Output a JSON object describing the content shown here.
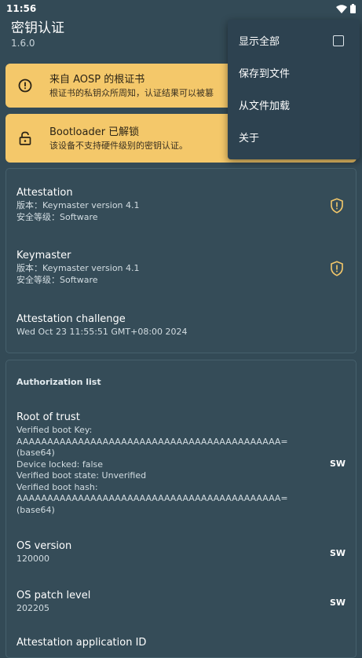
{
  "status_bar": {
    "time": "11:56"
  },
  "app_bar": {
    "title": "密钥认证",
    "version": "1.6.0"
  },
  "warnings": [
    {
      "title": "来自 AOSP 的根证书",
      "desc": "根证书的私钥众所周知，认证结果可以被篡"
    },
    {
      "title": "Bootloader 已解锁",
      "desc": "该设备不支持硬件级别的密钥认证。"
    }
  ],
  "menu": {
    "show_all": "显示全部",
    "save_to_file": "保存到文件",
    "load_from_file": "从文件加载",
    "about": "关于"
  },
  "attestation_card": {
    "attestation": {
      "title": "Attestation",
      "version": "版本：Keymaster version 4.1",
      "security": "安全等级：Software"
    },
    "keymaster": {
      "title": "Keymaster",
      "version": "版本：Keymaster version 4.1",
      "security": "安全等级：Software"
    },
    "challenge": {
      "title": "Attestation challenge",
      "value": "Wed Oct 23 11:55:51 GMT+08:00 2024"
    }
  },
  "authorization_card": {
    "header": "Authorization list",
    "root_of_trust": {
      "title": "Root of trust",
      "lines": [
        "Verified boot Key:",
        "AAAAAAAAAAAAAAAAAAAAAAAAAAAAAAAAAAAAAAAAAAA=",
        "(base64)",
        "Device locked: false",
        "Verified boot state: Unverified",
        "Verified boot hash:",
        "AAAAAAAAAAAAAAAAAAAAAAAAAAAAAAAAAAAAAAAAAAA=",
        "(base64)"
      ],
      "badge": "SW"
    },
    "os_version": {
      "title": "OS version",
      "value": "120000",
      "badge": "SW"
    },
    "os_patch_level": {
      "title": "OS patch level",
      "value": "202205",
      "badge": "SW"
    },
    "attestation_app_id": {
      "title": "Attestation application ID"
    }
  },
  "colors": {
    "background": "#334a56",
    "warning": "#f4c86a",
    "shield": "#f4c86a",
    "menu": "#2d4250"
  }
}
